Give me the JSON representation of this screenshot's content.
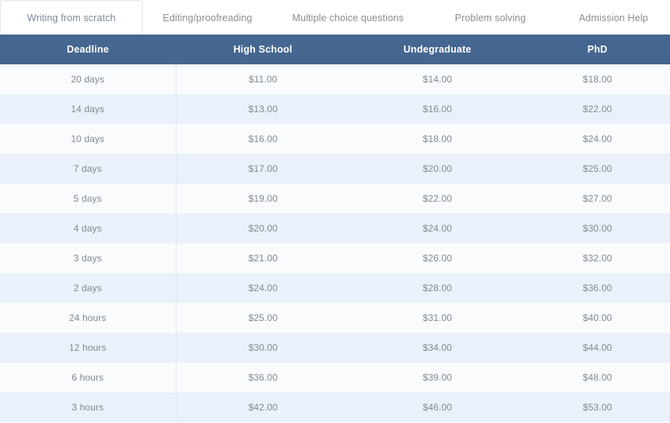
{
  "tabs": [
    {
      "label": "Writing from scratch",
      "active": true
    },
    {
      "label": "Editing/proofreading",
      "active": false
    },
    {
      "label": "Multiple choice questions",
      "active": false
    },
    {
      "label": "Problem solving",
      "active": false
    },
    {
      "label": "Admission Help",
      "active": false
    }
  ],
  "table": {
    "columns": [
      "Deadline",
      "High School",
      "Undegraduate",
      "PhD"
    ],
    "rows": [
      [
        "20 days",
        "$11.00",
        "$14.00",
        "$18.00"
      ],
      [
        "14 days",
        "$13.00",
        "$16.00",
        "$22.00"
      ],
      [
        "10 days",
        "$16.00",
        "$18.00",
        "$24.00"
      ],
      [
        "7 days",
        "$17.00",
        "$20.00",
        "$25.00"
      ],
      [
        "5 days",
        "$19.00",
        "$22.00",
        "$27.00"
      ],
      [
        "4 days",
        "$20.00",
        "$24.00",
        "$30.00"
      ],
      [
        "3 days",
        "$21.00",
        "$26.00",
        "$32.00"
      ],
      [
        "2 days",
        "$24.00",
        "$28.00",
        "$36.00"
      ],
      [
        "24 hours",
        "$25.00",
        "$31.00",
        "$40.00"
      ],
      [
        "12 hours",
        "$30.00",
        "$34.00",
        "$44.00"
      ],
      [
        "6 hours",
        "$36.00",
        "$39.00",
        "$48.00"
      ],
      [
        "3 hours",
        "$42.00",
        "$46.00",
        "$53.00"
      ]
    ]
  },
  "colors": {
    "header_background": "#456690",
    "header_text": "#ffffff",
    "row_odd": "#f9fbfd",
    "row_even": "#eaf1fb",
    "cell_text": "#7f8a95",
    "tab_inactive_text": "#8d8d8d",
    "tab_active_text": "#7c8a99",
    "tab_active_border": "#e3e7ea",
    "column_divider": "#dde5ec"
  }
}
